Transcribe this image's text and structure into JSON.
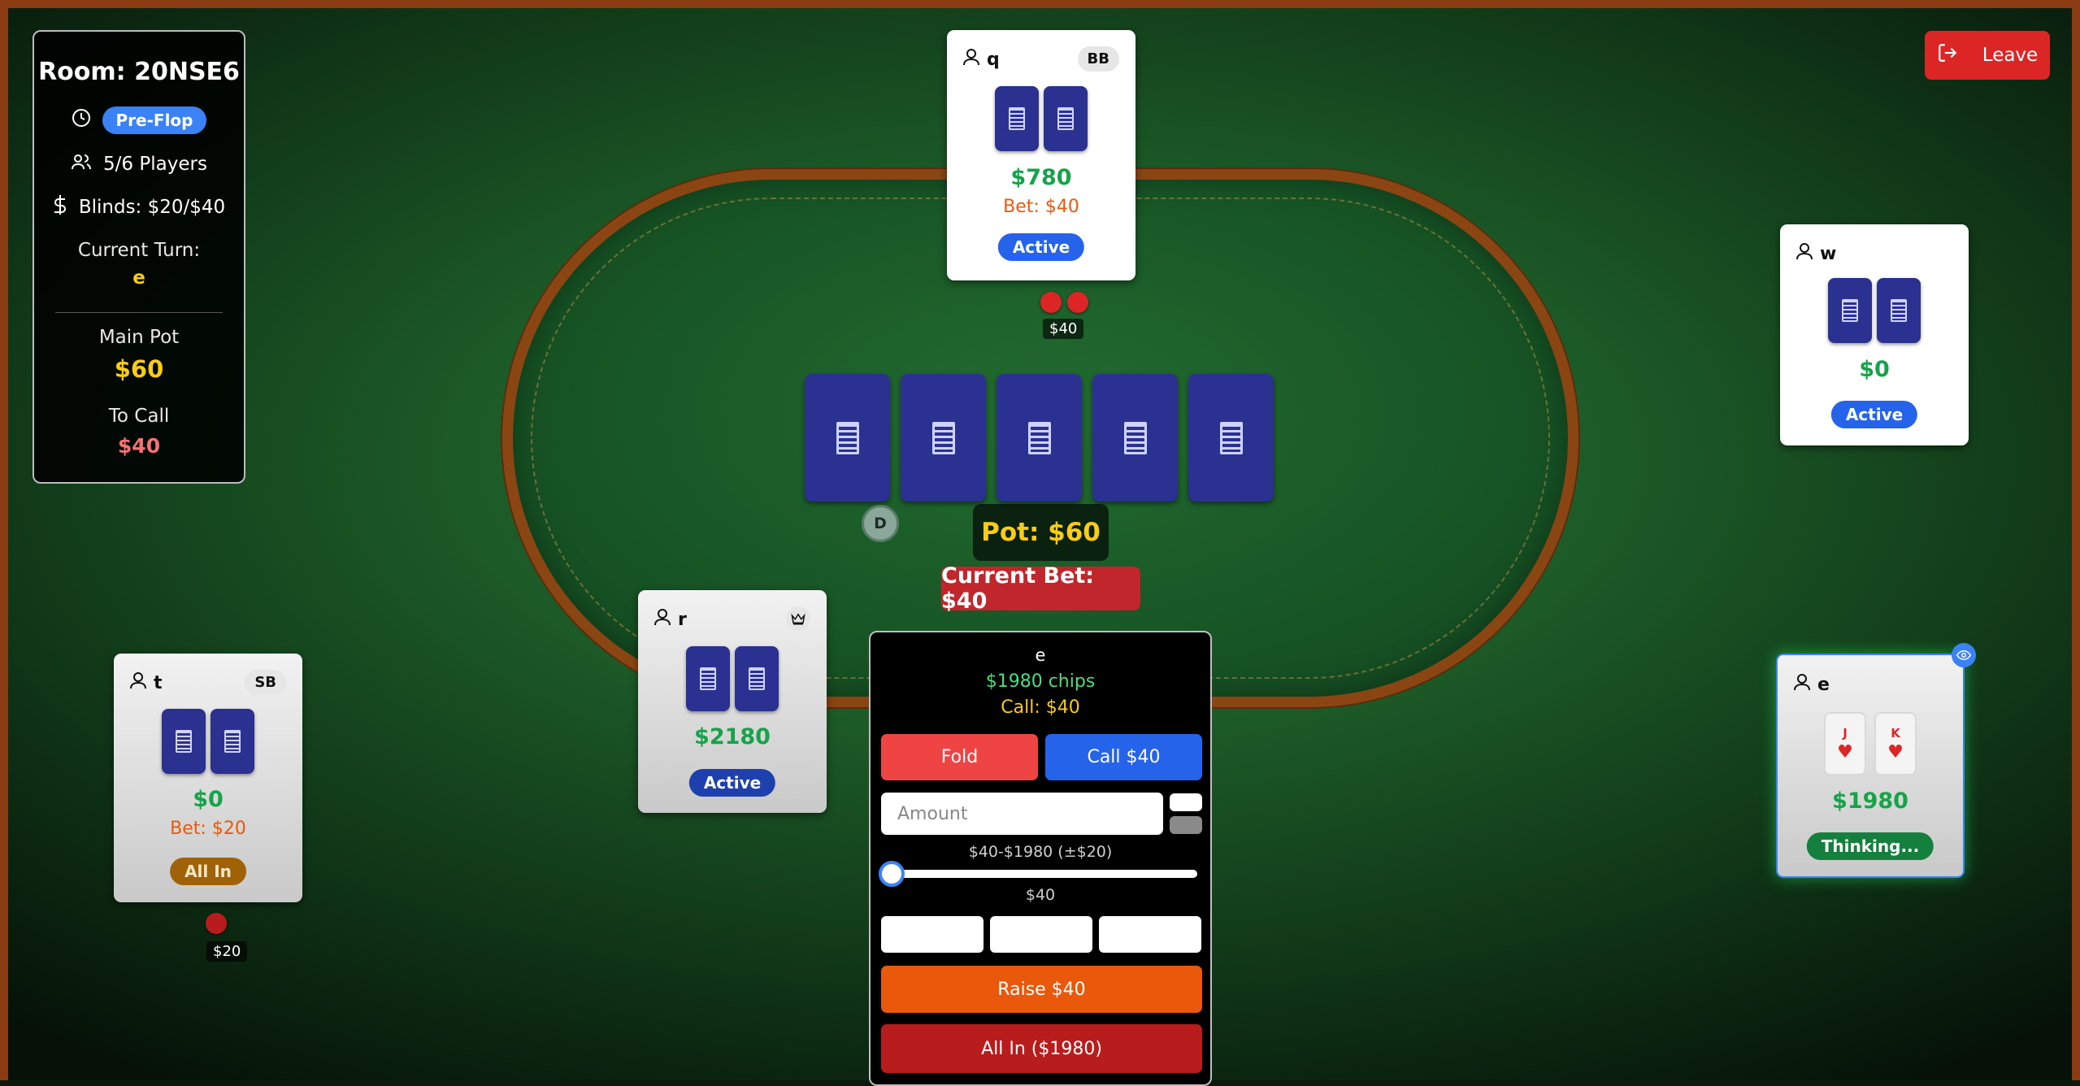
{
  "room": {
    "title": "Room: 20NSE6",
    "phase": "Pre-Flop",
    "players_count": "5/6 Players",
    "blinds": "Blinds: $20/$40",
    "current_turn_label": "Current Turn:",
    "current_turn_player": "e",
    "main_pot_label": "Main Pot",
    "main_pot_value": "$60",
    "to_call_label": "To Call",
    "to_call_value": "$40"
  },
  "header": {
    "leave_label": "Leave"
  },
  "players": {
    "q": {
      "name": "q",
      "role": "BB",
      "chips": "$780",
      "bet": "Bet: $40",
      "status": "Active"
    },
    "w": {
      "name": "w",
      "chips": "$0",
      "status": "Active"
    },
    "r": {
      "name": "r",
      "chips": "$2180",
      "status": "Active"
    },
    "t": {
      "name": "t",
      "role": "SB",
      "chips": "$0",
      "bet": "Bet: $20",
      "status": "All In"
    },
    "e": {
      "name": "e",
      "chips": "$1980",
      "status": "Thinking...",
      "cards": [
        {
          "rank": "J",
          "suit": "♥"
        },
        {
          "rank": "K",
          "suit": "♥"
        }
      ]
    }
  },
  "table": {
    "bet_q": "$40",
    "bet_t": "$20",
    "dealer_button": "D",
    "pot": "Pot: $60",
    "current_bet": "Current Bet: $40"
  },
  "action_panel": {
    "player_name": "e",
    "chips": "$1980 chips",
    "call_info": "Call: $40",
    "fold_label": "Fold",
    "call_label": "Call $40",
    "amount_placeholder": "Amount",
    "range_label": "$40-$1980 (±$20)",
    "slider_value": "$40",
    "slider_fraction": 0,
    "raise_label": "Raise $40",
    "allin_label": "All In ($1980)"
  },
  "colors": {
    "felt": "#1c5a27",
    "rail": "#8b4513",
    "card_back": "#2b3190",
    "accent_blue": "#2563eb",
    "danger_red": "#dc2626",
    "raise_orange": "#ea580c",
    "chips_green": "#16a34a",
    "gold": "#facc15"
  }
}
